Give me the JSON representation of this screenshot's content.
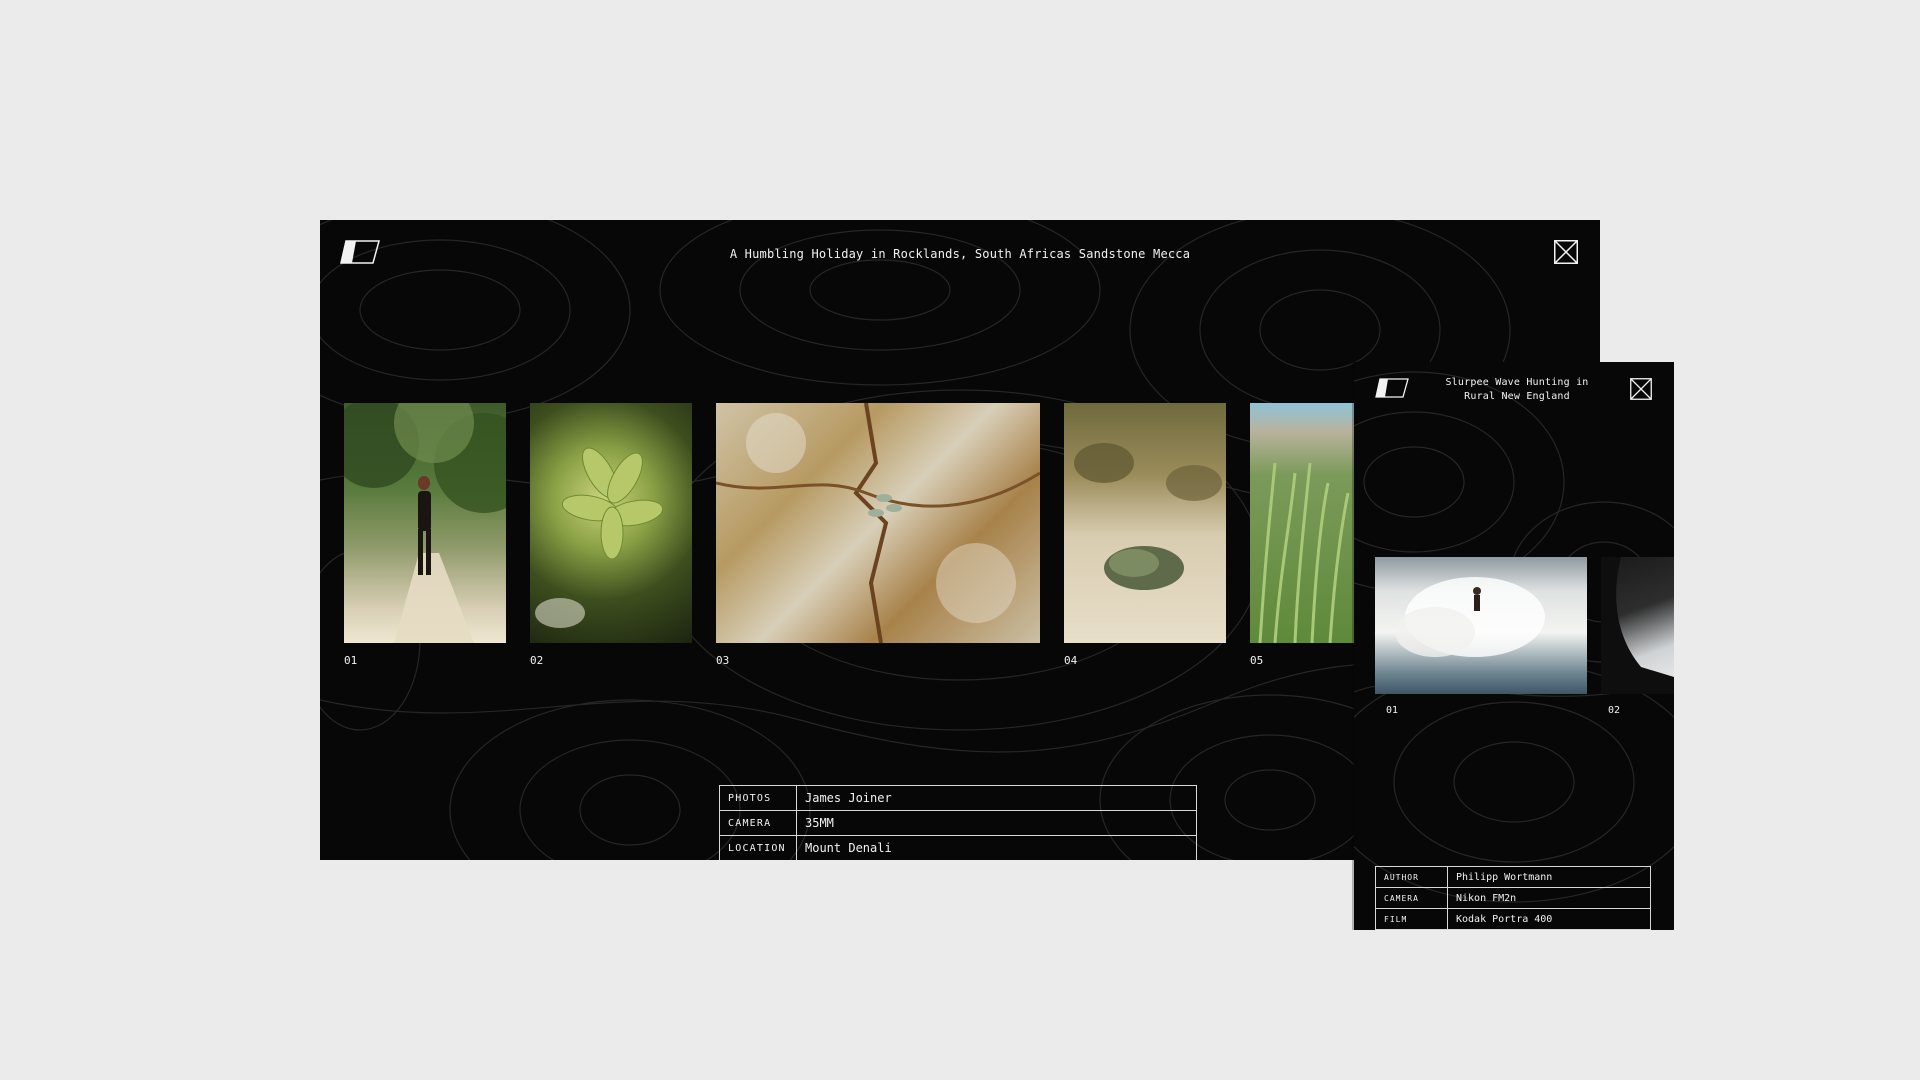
{
  "main_window": {
    "title": "A Humbling Holiday in Rocklands, South Africas Sandstone Mecca",
    "photos": [
      {
        "label": "01",
        "subject": "woman-on-trail"
      },
      {
        "label": "02",
        "subject": "succulent-leaves"
      },
      {
        "label": "03",
        "subject": "sandstone-rock-plant"
      },
      {
        "label": "04",
        "subject": "desert-shrub-trail"
      },
      {
        "label": "05",
        "subject": "green-reeds-sky"
      }
    ],
    "meta": [
      {
        "key": "PHOTOS",
        "value": "James Joiner"
      },
      {
        "key": "CAMERA",
        "value": "35MM"
      },
      {
        "key": "LOCATION",
        "value": "Mount Denali"
      }
    ]
  },
  "side_window": {
    "title": "Slurpee Wave Hunting in Rural New England",
    "photos": [
      {
        "label": "01",
        "subject": "surfer-in-wave-spray"
      },
      {
        "label": "02",
        "subject": "car-window-detail"
      }
    ],
    "meta": [
      {
        "key": "AUTHOR",
        "value": "Philipp Wortmann"
      },
      {
        "key": "CAMERA",
        "value": "Nikon FM2n"
      },
      {
        "key": "FILM",
        "value": "Kodak Portra 400"
      }
    ]
  },
  "icons": {
    "logo": "trapezoid-logo-icon",
    "close": "close-x-icon"
  },
  "colors": {
    "page_background": "#ebebeb",
    "window_background": "#070707",
    "text": "#f2f2f2",
    "topo_lines": "#2a2a2a"
  }
}
